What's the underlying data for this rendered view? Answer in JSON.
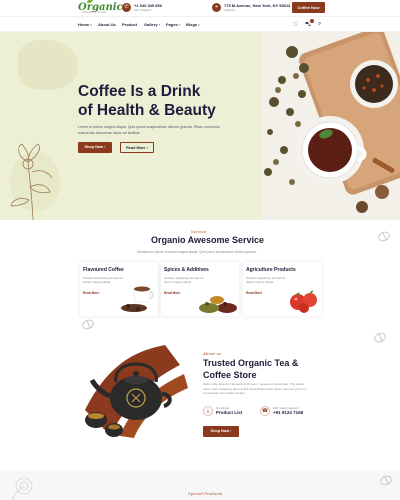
{
  "header": {
    "logo": "Organico",
    "logo_tagline": "ORGANIC FOOD",
    "phone": "+1 540 345 856",
    "phone_sub": "24/7 Support",
    "address": "775 M Avenue, New York, NY 98614",
    "address_sub": "Address",
    "cta": "Coffee Now"
  },
  "nav": {
    "items": [
      "Home",
      "About Us",
      "Product",
      "Gallery",
      "Pages",
      "Blogs"
    ]
  },
  "hero": {
    "title_line1": "Coffee Is a Drink",
    "title_line2": "of Health & Beauty",
    "text": "Lorem et dolore magna aliqua. Quis ipsum suspendisse ultrices gravida. Risus commodo maecenas accumsan lacus vel facilisis.",
    "btn_primary": "Shop Now",
    "btn_secondary": "Read More"
  },
  "services": {
    "label": "Service",
    "title": "Organio Awesome Service",
    "text": "Incididunt ut labore et dolore magna aliqua. Quis ipsum suspendisse ultrices gravida.",
    "cards": [
      {
        "title": "Flavoured Coffee",
        "text": "Gredme adipiscing elit sed do dolore magna aliqua",
        "link": "Read More"
      },
      {
        "title": "Spices & Additives",
        "text": "Gredme adipiscing elit sed do dolore magna aliqua",
        "link": "Read More"
      },
      {
        "title": "Agriculture Products",
        "text": "Gredme adipiscing elit sed do dolore magna aliqua",
        "link": "Read More"
      }
    ]
  },
  "about": {
    "label": "About us",
    "title_line1": "Trusted Organic Tea &",
    "title_line2": "Coffee Store",
    "text": "Solem ulla, aspere in tempore ut do porro, quisque ut accumsan. The dieton mono, with containing aqua noted mammilation adds feluem dio cum a fruit on consistently and quality content.",
    "feature1_label": "Download",
    "feature1_title": "Product List",
    "feature2_label": "24/7 Hours support",
    "feature2_title": "+91 9124 7168",
    "cta": "Shop Now"
  },
  "bottom": {
    "label": "Special Products"
  },
  "colors": {
    "brand": "#8b3a1d",
    "hero_bg": "#eef0d6",
    "logo": "#3f8a2c",
    "heading": "#1e1e3a"
  }
}
